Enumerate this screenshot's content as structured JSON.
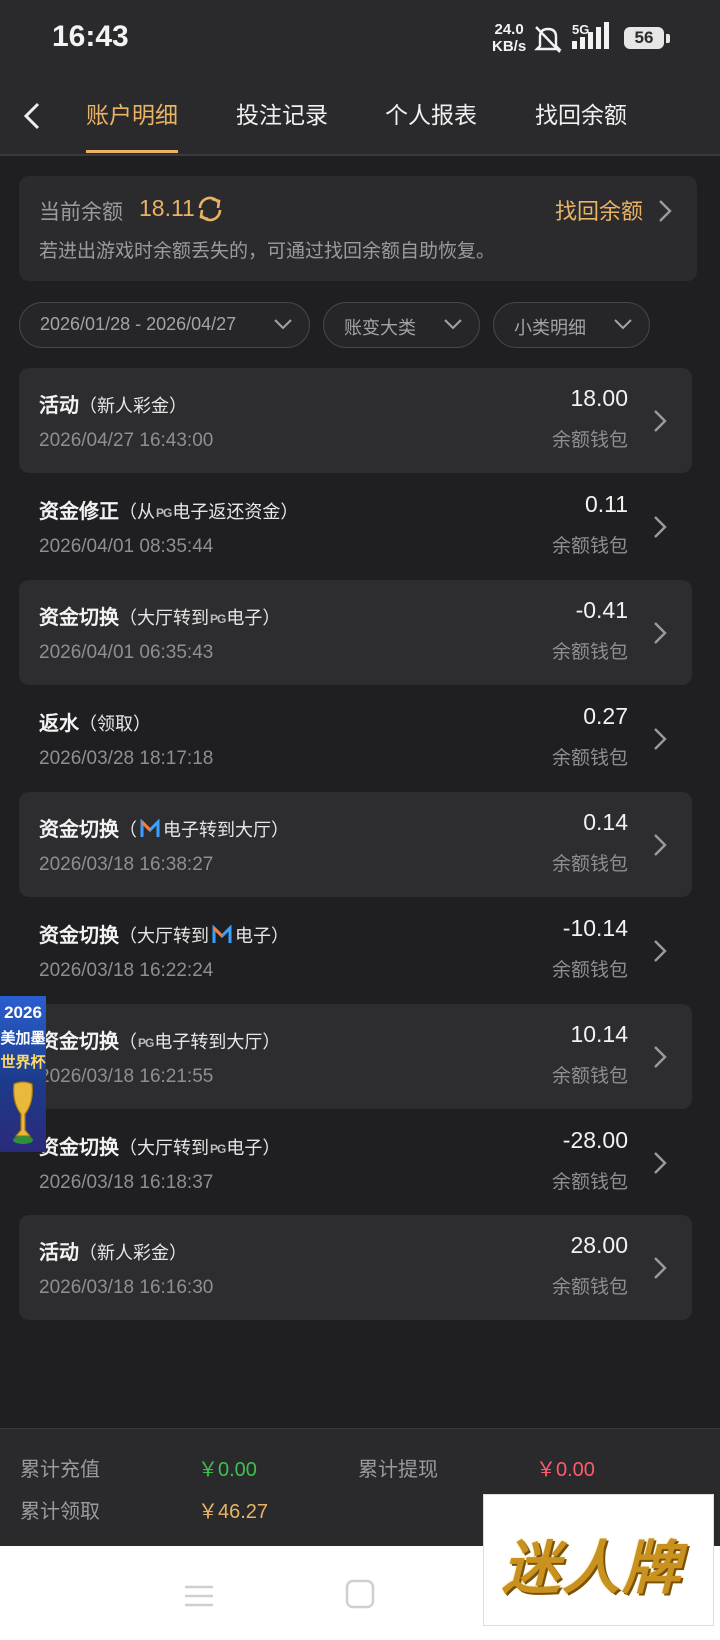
{
  "status_bar": {
    "time": "16:43",
    "net_speed_value": "24.0",
    "net_speed_unit": "KB/s",
    "network": "5G",
    "battery": "56"
  },
  "nav": {
    "tabs": [
      {
        "label": "账户明细",
        "active": true
      },
      {
        "label": "投注记录",
        "active": false
      },
      {
        "label": "个人报表",
        "active": false
      },
      {
        "label": "找回余额",
        "active": false
      }
    ]
  },
  "balance": {
    "label": "当前余额",
    "value": "18.11",
    "recover_label": "找回余额",
    "tip": "若进出游戏时余额丢失的，可通过找回余额自助恢复。"
  },
  "filters": {
    "date_range": "2026/01/28 - 2026/04/27",
    "category": "账变大类",
    "subcategory": "小类明细"
  },
  "transactions": [
    {
      "title": "活动",
      "detail": "（新人彩金）",
      "date": "2026/04/27 16:43:00",
      "amount": "18.00",
      "wallet": "余额钱包"
    },
    {
      "title": "资金修正",
      "detail_a": "（从",
      "badge": "PG",
      "detail_b": "电子返还资金）",
      "date": "2026/04/01 08:35:44",
      "amount": "0.11",
      "wallet": "余额钱包"
    },
    {
      "title": "资金切换",
      "detail_a": "（大厅转到",
      "badge": "PG",
      "detail_b": "电子）",
      "date": "2026/04/01 06:35:43",
      "amount": "-0.41",
      "wallet": "余额钱包"
    },
    {
      "title": "返水",
      "detail": "（领取）",
      "date": "2026/03/28 18:17:18",
      "amount": "0.27",
      "wallet": "余额钱包"
    },
    {
      "title": "资金切换",
      "detail_a": "（",
      "detail_b": "电子转到大厅）",
      "date": "2026/03/18 16:38:27",
      "amount": "0.14",
      "wallet": "余额钱包"
    },
    {
      "title": "资金切换",
      "detail_a": "（大厅转到",
      "detail_b": "电子）",
      "date": "2026/03/18 16:22:24",
      "amount": "-10.14",
      "wallet": "余额钱包"
    },
    {
      "title": "资金切换",
      "detail_a": "（",
      "badge": "PG",
      "detail_b": "电子转到大厅）",
      "date": "2026/03/18 16:21:55",
      "amount": "10.14",
      "wallet": "余额钱包"
    },
    {
      "title": "资金切换",
      "detail_a": "（大厅转到",
      "badge": "PG",
      "detail_b": "电子）",
      "date": "2026/03/18 16:18:37",
      "amount": "-28.00",
      "wallet": "余额钱包"
    },
    {
      "title": "活动",
      "detail": "（新人彩金）",
      "date": "2026/03/18 16:16:30",
      "amount": "28.00",
      "wallet": "余额钱包"
    }
  ],
  "promo": {
    "line1": "2026",
    "line2": "美加墨",
    "line3": "世界杯"
  },
  "totals": {
    "deposit_label": "累计充值",
    "deposit_value": "￥0.00",
    "withdraw_label": "累计提现",
    "withdraw_value": "￥0.00",
    "claimed_label": "累计领取",
    "claimed_value": "￥46.27"
  },
  "watermark": "迷人牌",
  "colors": {
    "accent": "#e9b365",
    "green": "#3fbf4f",
    "red": "#ff5a6e",
    "background": "#1f1f22",
    "card": "#2d2d30"
  }
}
